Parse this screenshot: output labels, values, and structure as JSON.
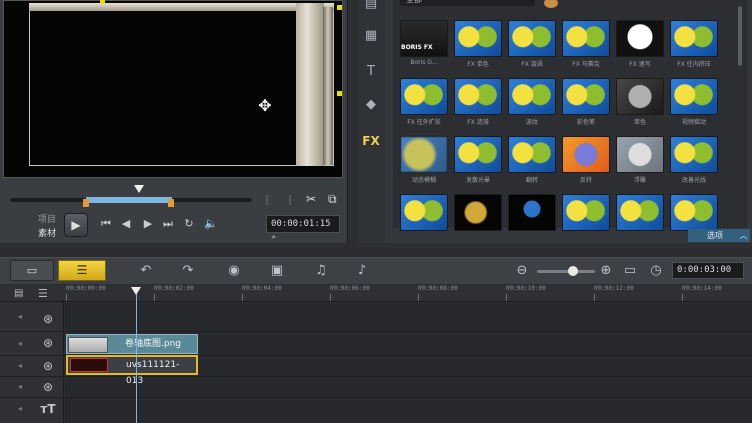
{
  "player": {
    "mode_project": "项目",
    "mode_clip": "素材",
    "timecode": "00:00:01:15 ⌃"
  },
  "library": {
    "dropdown": "全部",
    "boris_logo": "BORIS FX",
    "options_label": "选项",
    "thumbnails": [
      {
        "label": "Boris G...",
        "style": "boris"
      },
      {
        "label": "FX 单色",
        "style": ""
      },
      {
        "label": "FX 漩涡",
        "style": ""
      },
      {
        "label": "FX 马赛克",
        "style": ""
      },
      {
        "label": "FX 速写",
        "style": "bw"
      },
      {
        "label": "FX 往内挤压",
        "style": ""
      },
      {
        "label": "FX 往外扩张",
        "style": ""
      },
      {
        "label": "FX 涟漪",
        "style": ""
      },
      {
        "label": "波纹",
        "style": ""
      },
      {
        "label": "彩色笔",
        "style": ""
      },
      {
        "label": "单色",
        "style": "dark"
      },
      {
        "label": "视频摇动",
        "style": ""
      },
      {
        "label": "动态模糊",
        "style": "blur"
      },
      {
        "label": "发散光晕",
        "style": ""
      },
      {
        "label": "翻转",
        "style": ""
      },
      {
        "label": "反转",
        "style": "orange"
      },
      {
        "label": "浮雕",
        "style": "pale"
      },
      {
        "label": "改善光线",
        "style": ""
      },
      {
        "label": "",
        "style": ""
      },
      {
        "label": "",
        "style": "night"
      },
      {
        "label": "",
        "style": "mini"
      },
      {
        "label": "",
        "style": ""
      },
      {
        "label": "",
        "style": ""
      },
      {
        "label": "",
        "style": ""
      }
    ]
  },
  "timeline": {
    "duration": "0:00:03:00",
    "ruler_ticks": [
      "00:00:00:00",
      "00:00:02:00",
      "00:00:04:00",
      "00:00:06:00",
      "00:00:08:00",
      "00:00:10:00",
      "00:00:12:00",
      "00:00:14:00"
    ],
    "clips": {
      "overlay": "卷轴底图.png",
      "video": "uvs111121-013"
    }
  },
  "icons": {
    "cut": "scissors-icon",
    "copy": "copy-icon",
    "move": "move-cursor-icon"
  }
}
